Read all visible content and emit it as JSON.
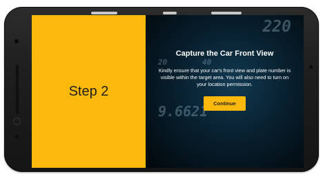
{
  "step_panel": {
    "label": "Step 2"
  },
  "capture": {
    "title": "Capture the Car Front View",
    "description": "Kindly ensure that your car's front view and plate number is visible within the target area. You will also need to turn on your location permission.",
    "button_label": "Continue"
  },
  "background": {
    "speedometer_readout": "220",
    "gauge_readout": "9.6621",
    "tick_20": "20",
    "tick_40": "40"
  },
  "colors": {
    "accent": "#fbb90b",
    "screen_bg": "#06131c",
    "device_body": "#1e1e1e"
  }
}
